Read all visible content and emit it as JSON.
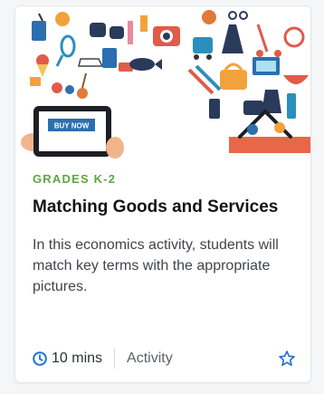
{
  "card": {
    "grade": "GRADES K-2",
    "title": "Matching Goods and Services",
    "description": "In this economics activity, students will match key terms with the appropriate pictures.",
    "tablet_button": "BUY NOW",
    "duration": "10 mins",
    "type": "Activity",
    "colors": {
      "grade": "#5ea644",
      "accent": "#1f6fd1",
      "basket": "#e8674a"
    },
    "icons": [
      "clock-icon",
      "star-icon"
    ]
  }
}
